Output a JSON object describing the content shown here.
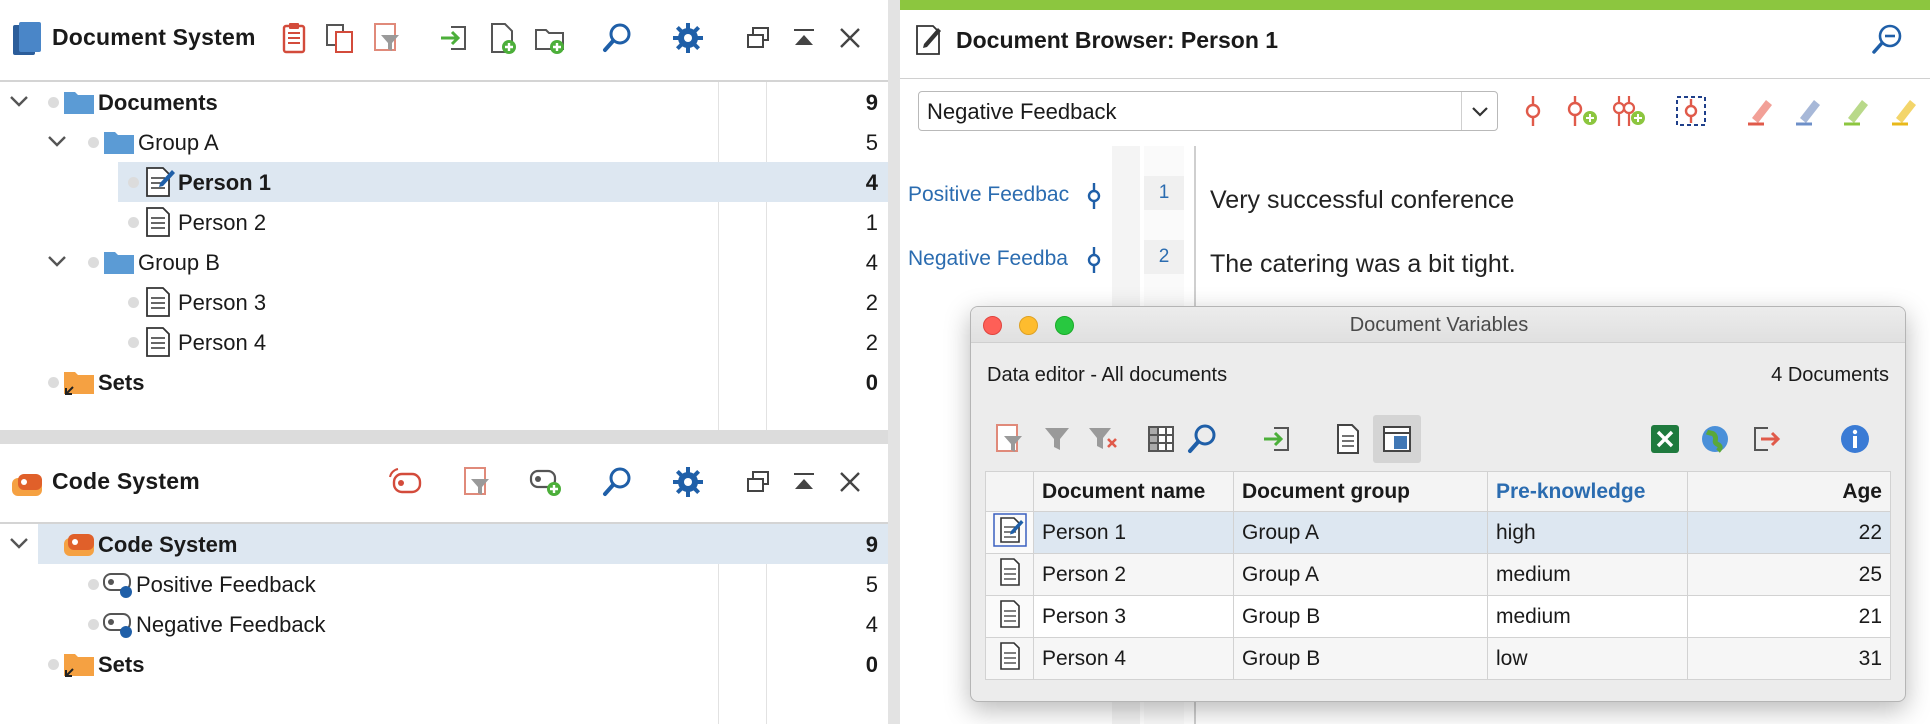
{
  "document_system": {
    "title": "Document System",
    "rows": [
      {
        "label": "Documents",
        "count": "9"
      },
      {
        "label": "Group A",
        "count": "5"
      },
      {
        "label": "Person 1",
        "count": "4"
      },
      {
        "label": "Person 2",
        "count": "1"
      },
      {
        "label": "Group B",
        "count": "4"
      },
      {
        "label": "Person 3",
        "count": "2"
      },
      {
        "label": "Person 4",
        "count": "2"
      },
      {
        "label": "Sets",
        "count": "0"
      }
    ]
  },
  "code_system": {
    "title": "Code System",
    "rows": [
      {
        "label": "Code System",
        "count": "9"
      },
      {
        "label": "Positive Feedback",
        "count": "5"
      },
      {
        "label": "Negative Feedback",
        "count": "4"
      },
      {
        "label": "Sets",
        "count": "0"
      }
    ]
  },
  "document_browser": {
    "title": "Document Browser: Person 1",
    "selected_code": "Negative Feedback",
    "code_labels": [
      "Positive Feedbac",
      "Negative Feedba"
    ],
    "paragraphs": [
      {
        "num": "1",
        "text": "Very successful conference"
      },
      {
        "num": "2",
        "text": "The catering was a bit tight."
      }
    ]
  },
  "document_variables": {
    "window_title": "Document Variables",
    "subtitle": "Data editor - All documents",
    "doc_count": "4 Documents",
    "columns": [
      "Document name",
      "Document group",
      "Pre-knowledge",
      "Age"
    ],
    "rows": [
      {
        "name": "Person 1",
        "group": "Group A",
        "knowledge": "high",
        "age": "22"
      },
      {
        "name": "Person 2",
        "group": "Group A",
        "knowledge": "medium",
        "age": "25"
      },
      {
        "name": "Person 3",
        "group": "Group B",
        "knowledge": "medium",
        "age": "21"
      },
      {
        "name": "Person 4",
        "group": "Group B",
        "knowledge": "low",
        "age": "31"
      }
    ]
  },
  "colors": {
    "accent_blue": "#2b6cb0",
    "selection": "#dde7f1",
    "folder_blue": "#5b9bd5",
    "folder_orange": "#f5a142",
    "active_green": "#8cc63f"
  }
}
